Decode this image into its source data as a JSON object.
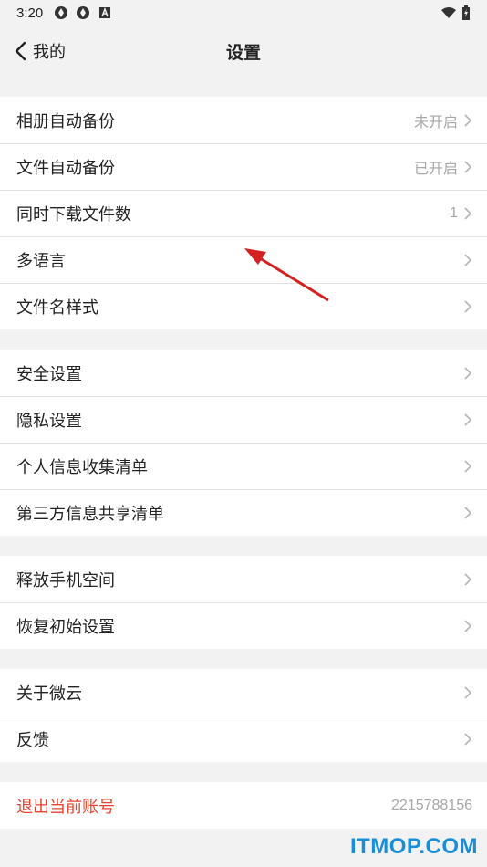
{
  "status_bar": {
    "time": "3:20"
  },
  "header": {
    "back_label": "我的",
    "title": "设置"
  },
  "groups": [
    [
      {
        "label": "相册自动备份",
        "value": "未开启"
      },
      {
        "label": "文件自动备份",
        "value": "已开启"
      },
      {
        "label": "同时下载文件数",
        "value": "1"
      },
      {
        "label": "多语言",
        "value": ""
      },
      {
        "label": "文件名样式",
        "value": ""
      }
    ],
    [
      {
        "label": "安全设置",
        "value": ""
      },
      {
        "label": "隐私设置",
        "value": ""
      },
      {
        "label": "个人信息收集清单",
        "value": ""
      },
      {
        "label": "第三方信息共享清单",
        "value": ""
      }
    ],
    [
      {
        "label": "释放手机空间",
        "value": ""
      },
      {
        "label": "恢复初始设置",
        "value": ""
      }
    ],
    [
      {
        "label": "关于微云",
        "value": ""
      },
      {
        "label": "反馈",
        "value": ""
      }
    ]
  ],
  "logout": {
    "label": "退出当前账号",
    "account": "2215788156"
  },
  "watermark": "ITMOP.COM",
  "colors": {
    "danger": "#e8432e",
    "watermark": "#1a8fd8",
    "annotation_arrow": "#d42020"
  }
}
